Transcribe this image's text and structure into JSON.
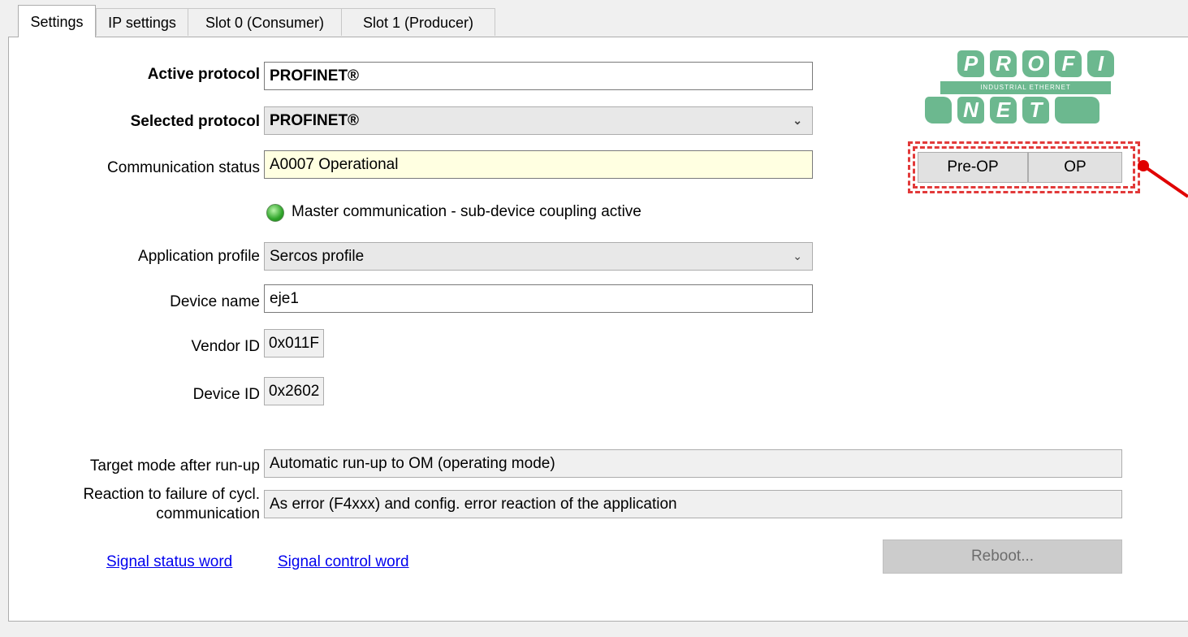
{
  "tabs": [
    {
      "label": "Settings",
      "active": true
    },
    {
      "label": "IP settings",
      "active": false
    },
    {
      "label": "Slot 0 (Consumer)",
      "active": false
    },
    {
      "label": "Slot 1 (Producer)",
      "active": false
    }
  ],
  "form": {
    "active_protocol": {
      "label": "Active protocol",
      "value": "PROFINET®"
    },
    "selected_protocol": {
      "label": "Selected protocol",
      "value": "PROFINET®"
    },
    "communication_status": {
      "label": "Communication status",
      "value": "A0007 Operational"
    },
    "master_status": "Master communication - sub-device coupling active",
    "application_profile": {
      "label": "Application profile",
      "value": "Sercos profile"
    },
    "device_name": {
      "label": "Device name",
      "value": "eje1"
    },
    "vendor_id": {
      "label": "Vendor ID",
      "value": "0x011F"
    },
    "device_id": {
      "label": "Device ID",
      "value": "0x2602"
    },
    "target_mode": {
      "label": "Target mode after run-up",
      "value": "Automatic run-up to OM (operating mode)"
    },
    "reaction": {
      "label_line1": "Reaction to failure of cycl.",
      "label_line2": "communication",
      "value": "As error (F4xxx) and config. error reaction of the application"
    }
  },
  "buttons": {
    "pre_op": "Pre-OP",
    "op": "OP",
    "reboot": "Reboot..."
  },
  "links": {
    "signal_status_word": "Signal status word",
    "signal_control_word": "Signal control word"
  },
  "logo": {
    "top": [
      "P",
      "R",
      "O",
      "F",
      "I"
    ],
    "tagline": "INDUSTRIAL ETHERNET",
    "bottom": [
      "N",
      "E",
      "T"
    ]
  },
  "colors": {
    "status_background": "#ffffe1",
    "annotation": "#e23a3a",
    "logo_green": "#6cb88f",
    "link": "#0000ee"
  }
}
